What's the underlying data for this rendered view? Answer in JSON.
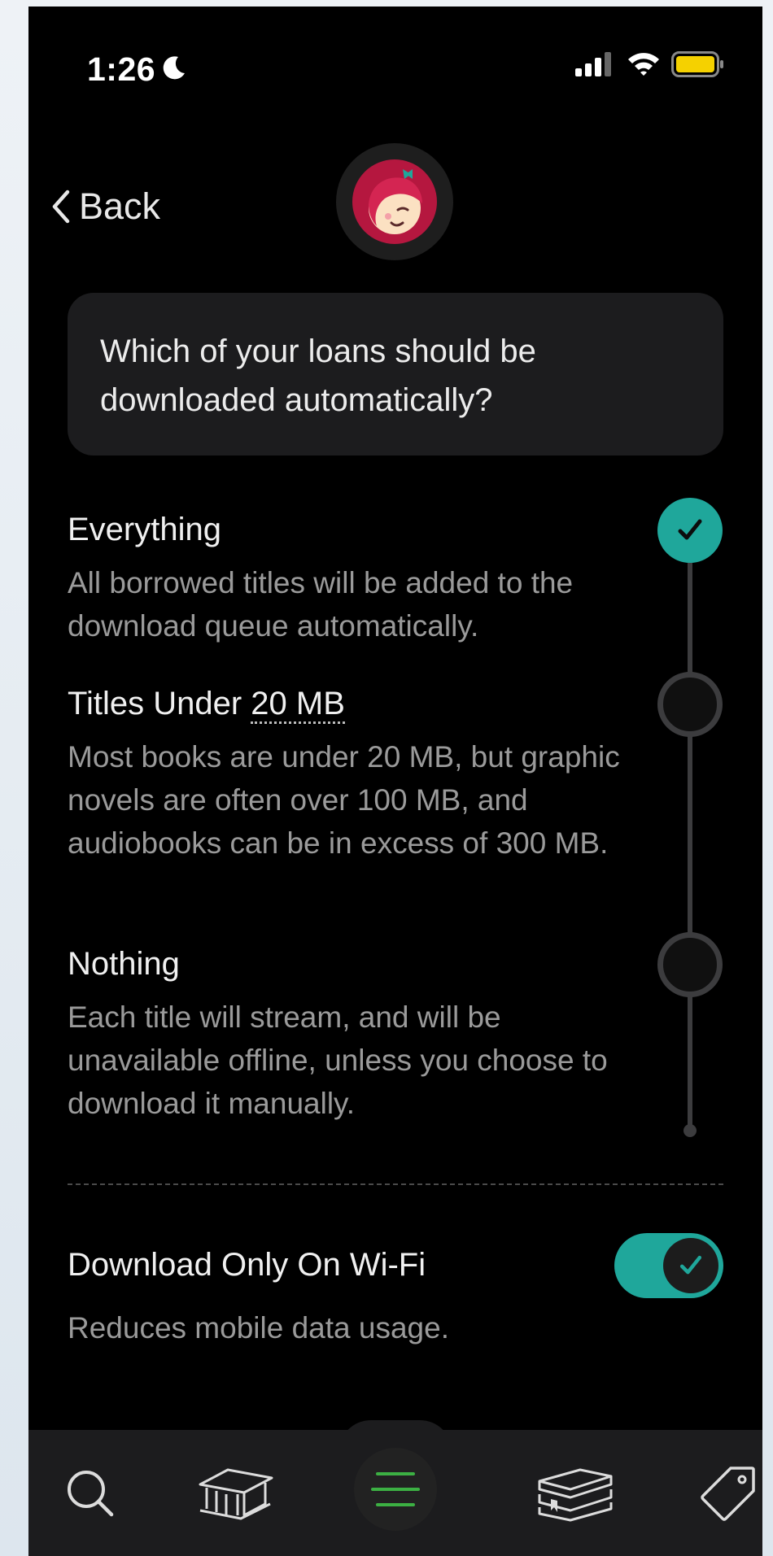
{
  "status_bar": {
    "time": "1:26",
    "icons": [
      "moon-icon",
      "cellular-signal-icon",
      "wifi-icon",
      "battery-icon"
    ],
    "battery_color": "#f5d100"
  },
  "nav": {
    "back_label": "Back",
    "avatar_icon": "libby-logo-icon"
  },
  "question": "Which of your loans should be downloaded automatically?",
  "options": [
    {
      "title": "Everything",
      "description": "All borrowed titles will be added to the download queue automatically.",
      "selected": true
    },
    {
      "title_prefix": "Titles Under ",
      "title_size": "20 MB",
      "description": "Most books are under 20 MB, but graphic novels are often over 100 MB, and audiobooks can be in excess of 300 MB.",
      "selected": false
    },
    {
      "title": "Nothing",
      "description": "Each title will stream, and will be unavailable offline, unless you choose to download it manually.",
      "selected": false
    }
  ],
  "wifi_setting": {
    "title": "Download Only On Wi-Fi",
    "description": "Reduces mobile data usage.",
    "enabled": true
  },
  "tab_bar": {
    "tabs": [
      "search-icon",
      "library-icon",
      "menu-icon",
      "shelf-icon",
      "tag-icon"
    ]
  },
  "colors": {
    "accent": "#1fa79b",
    "background": "#000000",
    "card": "#1c1c1e",
    "menu_green": "#3cb043",
    "avatar_red": "#b5173f"
  }
}
